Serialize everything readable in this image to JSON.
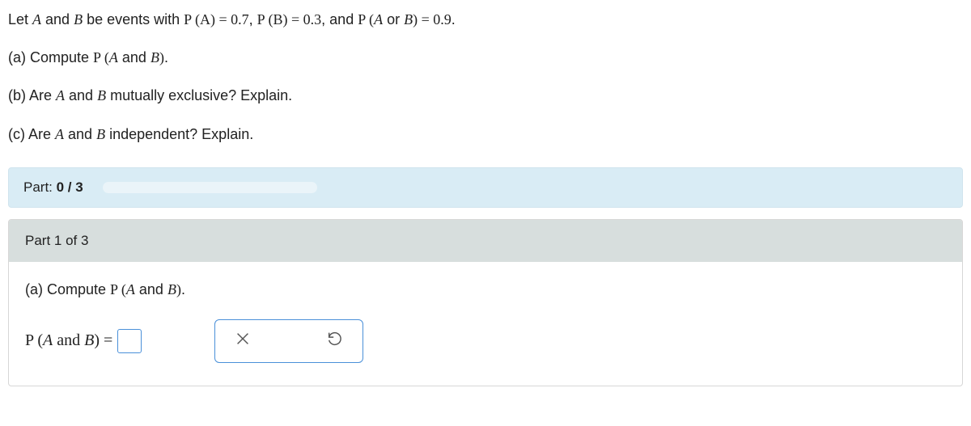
{
  "problem": {
    "intro_pre": "Let ",
    "A": "A",
    "and1": " and ",
    "B": "B",
    "intro_mid1": " be events with ",
    "PA_lhs": "P (A)",
    "eq1": " = ",
    "PA_val": "0.7",
    "comma1": ",  ",
    "PB_lhs": "P (B)",
    "eq2": " = ",
    "PB_val": "0.3",
    "comma2": ",  and ",
    "PAorB_lhs_P": "P (",
    "PAorB_A": "A",
    "PAorB_or": "  or  ",
    "PAorB_B": "B",
    "PAorB_rparen": ")",
    "eq3": " = ",
    "PAorB_val": "0.9",
    "period": ".",
    "a_label": "(a) Compute ",
    "a_expr_P": "P (",
    "a_expr_A": "A",
    "a_expr_and": "  and  ",
    "a_expr_B": "B",
    "a_expr_rparen": ")",
    "a_period": ".",
    "b_text_pre": "(b) Are ",
    "b_A": "A",
    "b_and": " and ",
    "b_B": "B",
    "b_text_post": " mutually exclusive? Explain.",
    "c_text_pre": "(c) Are ",
    "c_A": "A",
    "c_and": " and ",
    "c_B": "B",
    "c_text_post": " independent? Explain."
  },
  "progress": {
    "label_pre": "Part: ",
    "label_val": "0 / 3",
    "percent": 0
  },
  "part_card": {
    "header": "Part 1 of 3",
    "sub_a_label": "(a) Compute ",
    "sub_a_P": "P (",
    "sub_a_A": "A",
    "sub_a_and": "  and  ",
    "sub_a_B": "B",
    "sub_a_rparen": ")",
    "sub_a_period": ".",
    "answer_lhs_P": "P (",
    "answer_lhs_A": "A",
    "answer_lhs_and": "  and  ",
    "answer_lhs_B": "B",
    "answer_lhs_rparen": ")",
    "answer_eq": "  =  "
  },
  "icons": {
    "clear": "clear-icon",
    "reset": "reset-icon"
  }
}
